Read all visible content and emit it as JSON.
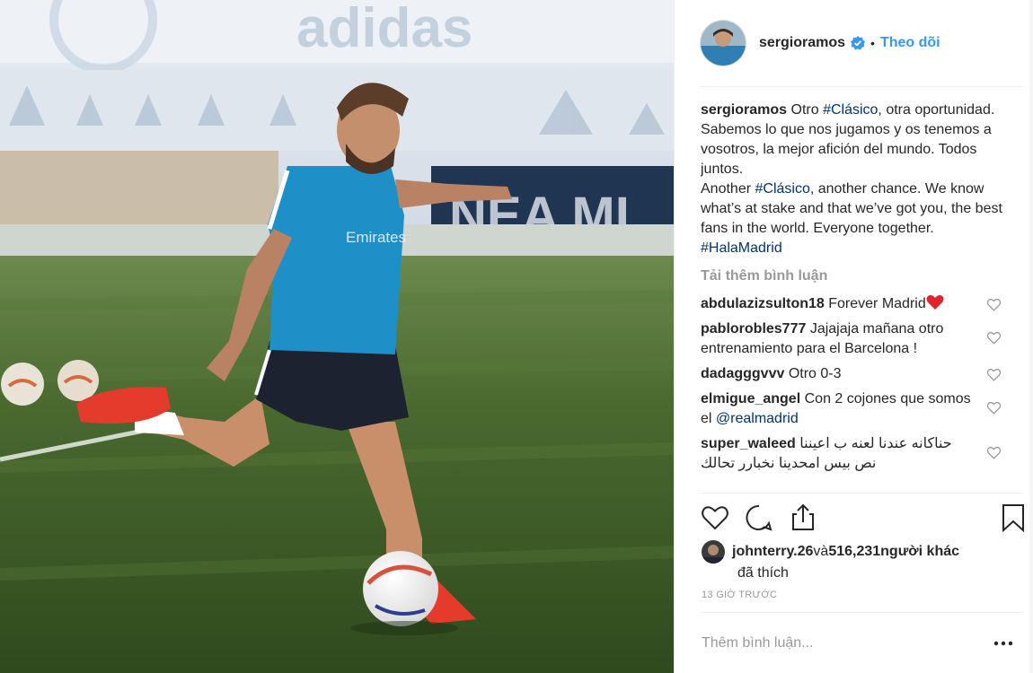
{
  "post": {
    "username": "sergioramos",
    "follow_label": "Theo dõi",
    "separator": "•",
    "caption": {
      "line1_pre": "Otro ",
      "line1_tag": "#Clásico",
      "line1_post": ", otra oportunidad. Sabemos lo que nos jugamos y os tenemos a vosotros, la mejor afición del mundo. Todos juntos.",
      "line2_pre": "Another ",
      "line2_tag": "#Clásico",
      "line2_post": ", another chance. We know what’s at stake and that we’ve got you, the best fans in the world. Everyone together.",
      "line3_tag": "#HalaMadrid"
    },
    "load_more": "Tải thêm bình luận",
    "comments": [
      {
        "user": "abdulazizsulton18",
        "text": "Forever Madrid"
      },
      {
        "user": "pablorobles777",
        "text": "Jajajaja mañana otro entrenamiento para el Barcelona !"
      },
      {
        "user": "dadagggvvv",
        "text": "Otro 0-3"
      },
      {
        "user": "elmigue_angel",
        "text_pre": "Con 2 cojones que somos el ",
        "mention": "@realmadrid"
      },
      {
        "user": "super_waleed",
        "text": "حناكانه عندنا لعنه ب اعيننا نص بيس امحدينا نخبارر تحالك"
      }
    ],
    "likes": {
      "user": "johnterry.26",
      "middle": " và ",
      "count": "516,231",
      "suffix": " người khác",
      "line2": "đã thích"
    },
    "timestamp": "13 giờ trước",
    "add_comment_placeholder": "Thêm bình luận..."
  },
  "photo": {
    "banner_text": "adidas",
    "ball_color": "#ffffff"
  },
  "icons": {
    "verified": "verified-badge-icon",
    "heart": "heart-outline-icon",
    "comment": "comment-bubble-icon",
    "share": "share-upload-icon",
    "bookmark": "bookmark-icon",
    "options": "ellipsis-icon"
  },
  "colors": {
    "link": "#3897f0",
    "hashtag": "#003569",
    "muted": "#999999",
    "text": "#262626",
    "like_red": "#ed4956"
  }
}
